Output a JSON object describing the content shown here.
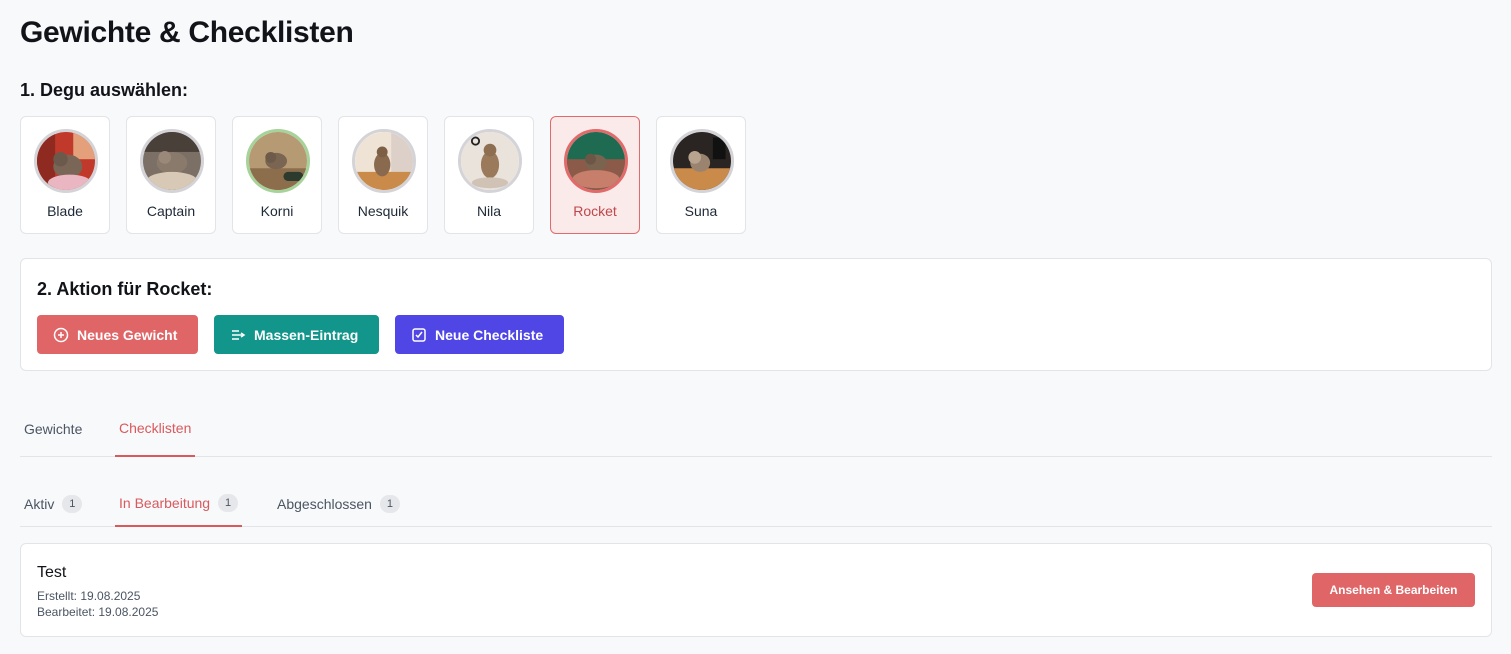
{
  "page_title": "Gewichte & Checklisten",
  "step1_label": "1. Degu auswählen:",
  "degus": [
    {
      "name": "Blade",
      "selected": false
    },
    {
      "name": "Captain",
      "selected": false
    },
    {
      "name": "Korni",
      "selected": false
    },
    {
      "name": "Nesquik",
      "selected": false
    },
    {
      "name": "Nila",
      "selected": false
    },
    {
      "name": "Rocket",
      "selected": true
    },
    {
      "name": "Suna",
      "selected": false
    }
  ],
  "action_panel": {
    "title": "2. Aktion für Rocket:",
    "buttons": {
      "new_weight": "Neues Gewicht",
      "bulk_entry": "Massen-Eintrag",
      "new_checklist": "Neue Checkliste"
    }
  },
  "main_tabs": {
    "weights": "Gewichte",
    "checklists": "Checklisten",
    "active": "checklists"
  },
  "sub_tabs": {
    "active_label": "Aktiv",
    "active_count": "1",
    "in_progress_label": "In Bearbeitung",
    "in_progress_count": "1",
    "done_label": "Abgeschlossen",
    "done_count": "1",
    "selected": "in_progress"
  },
  "checklist_item": {
    "title": "Test",
    "created": "Erstellt: 19.08.2025",
    "edited": "Bearbeitet: 19.08.2025",
    "view_button": "Ansehen & Bearbeiten"
  },
  "colors": {
    "accent_red": "#df6567",
    "teal": "#12958a",
    "indigo": "#4f46e5"
  },
  "icons": {
    "new_weight": "plus-circle-icon",
    "bulk_entry": "list-arrow-icon",
    "new_checklist": "check-square-icon"
  }
}
